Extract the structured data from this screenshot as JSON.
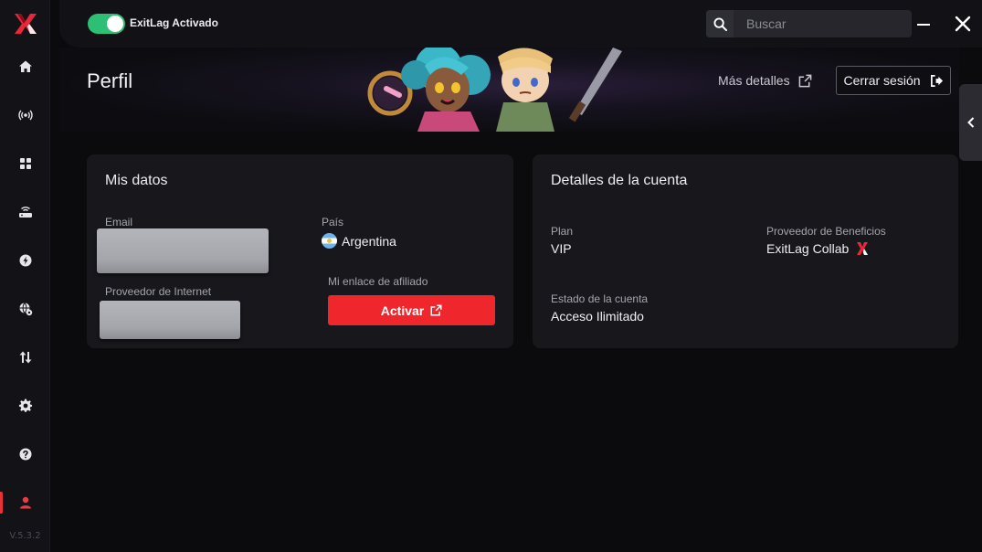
{
  "app": {
    "version": "V.5.3.2",
    "vpn_toggle": {
      "label": "ExitLag Activado",
      "state": "on"
    },
    "search": {
      "placeholder": "Buscar"
    }
  },
  "sidebar": {
    "items": [
      {
        "id": "home",
        "icon": "home-icon"
      },
      {
        "id": "broadcast",
        "icon": "broadcast-icon"
      },
      {
        "id": "apps",
        "icon": "grid-icon"
      },
      {
        "id": "router",
        "icon": "router-icon"
      },
      {
        "id": "boost",
        "icon": "lightning-icon"
      },
      {
        "id": "network",
        "icon": "globe-settings-icon"
      },
      {
        "id": "transfer",
        "icon": "transfer-arrows-icon"
      },
      {
        "id": "settings",
        "icon": "gear-icon"
      },
      {
        "id": "help",
        "icon": "question-icon"
      },
      {
        "id": "profile",
        "icon": "user-icon",
        "active": true
      }
    ]
  },
  "header": {
    "title": "Perfil",
    "more_details": "Más detalles",
    "logout": "Cerrar sesión"
  },
  "my_data": {
    "title": "Mis datos",
    "email_label": "Email",
    "email_value_redacted": true,
    "country_label": "País",
    "country_value": "Argentina",
    "isp_label": "Proveedor de Internet",
    "isp_value_redacted": true,
    "affiliate_label": "Mi enlace de afiliado",
    "activate_button": "Activar"
  },
  "account": {
    "title": "Detalles de la cuenta",
    "plan_label": "Plan",
    "plan_value": "VIP",
    "benefits_label": "Proveedor de Beneficios",
    "benefits_value": "ExitLag Collab",
    "status_label": "Estado de la cuenta",
    "status_value": "Acceso Ilimitado"
  },
  "colors": {
    "accent_red": "#f0262d",
    "toggle_green": "#2dbf73",
    "card_bg": "#17171c"
  }
}
